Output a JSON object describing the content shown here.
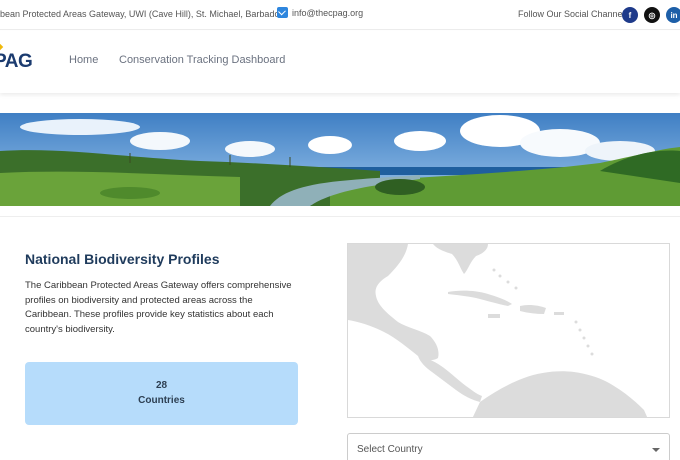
{
  "topbar": {
    "address": "bean Protected Areas Gateway, UWI (Cave Hill), St. Michael, Barbados",
    "email_icon": "email-icon",
    "email": "info@thecpag.org",
    "follow_text": "Follow Our Social Channels",
    "social": [
      {
        "icon": "facebook-icon",
        "glyph": "f"
      },
      {
        "icon": "instagram-icon",
        "glyph": "◎"
      },
      {
        "icon": "linkedin-icon",
        "glyph": "in"
      }
    ]
  },
  "nav": {
    "logo_text": "PAG",
    "links": [
      "Home",
      "Conservation Tracking Dashboard"
    ]
  },
  "main": {
    "title": "National Biodiversity Profiles",
    "description": "The Caribbean Protected Areas Gateway offers comprehensive profiles on biodiversity and protected areas across the Caribbean. These profiles provide key statistics about each country's biodiversity.",
    "stat": {
      "value": "28",
      "label": "Countries"
    },
    "select": {
      "value": "Select Country"
    }
  },
  "colors": {
    "accent": "#1b3b6f",
    "stat_bg": "#b6dcfb",
    "land": "#dcdcdc",
    "title": "#1f3b5c"
  }
}
